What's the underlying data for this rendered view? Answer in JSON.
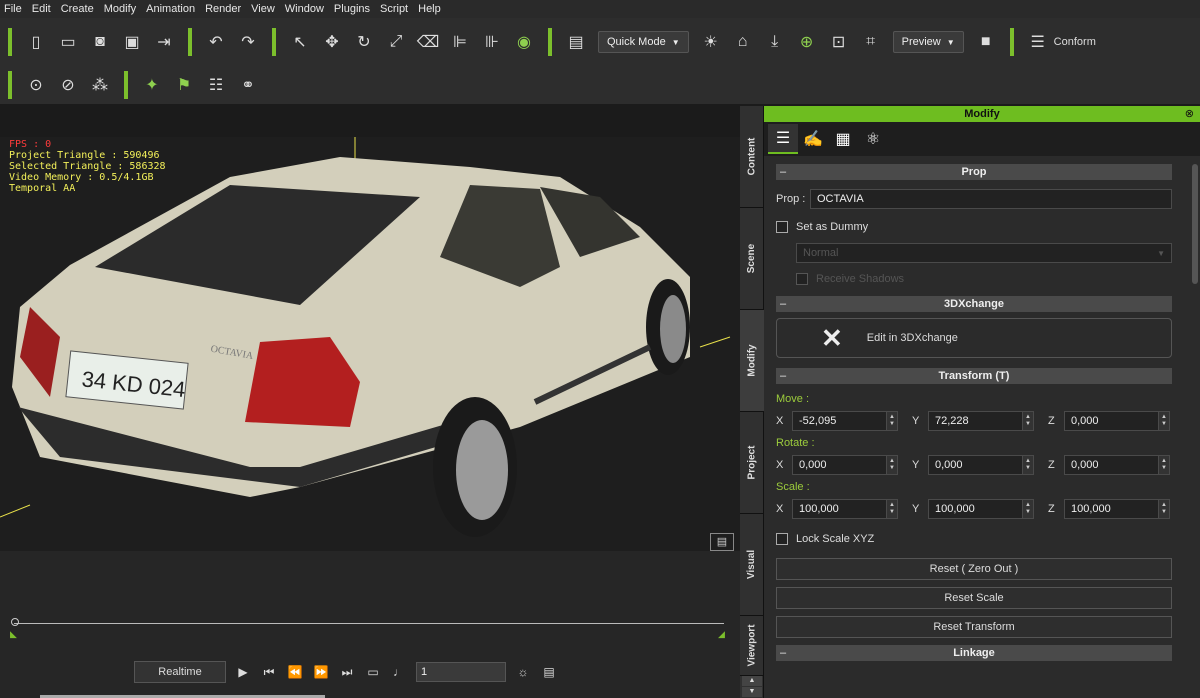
{
  "menu": [
    "File",
    "Edit",
    "Create",
    "Modify",
    "Animation",
    "Render",
    "View",
    "Window",
    "Plugins",
    "Script",
    "Help"
  ],
  "toolbar": {
    "quick_mode": "Quick Mode",
    "preview": "Preview",
    "conform": "Conform"
  },
  "viewport": {
    "stats": {
      "fps": "FPS : 0",
      "project_triangle": "Project Triangle : 590496",
      "selected_triangle": "Selected Triangle : 586328",
      "video_memory": "Video Memory : 0.5/4.1GB",
      "temporal_aa": "Temporal AA"
    },
    "plate": "34 KD 024",
    "badge": "OCTAVIA"
  },
  "playback": {
    "realtime": "Realtime",
    "frame": "1"
  },
  "side_tabs": [
    "Content",
    "Scene",
    "Modify",
    "Project",
    "Visual",
    "Viewport"
  ],
  "panel": {
    "title": "Modify",
    "sections": {
      "prop": "Prop",
      "xchange": "3DXchange",
      "transform": "Transform  (T)",
      "linkage": "Linkage"
    },
    "prop_label": "Prop :",
    "prop_value": "OCTAVIA",
    "set_as_dummy": "Set as Dummy",
    "normal": "Normal",
    "receive_shadows": "Receive Shadows",
    "edit_3dx": "Edit in 3DXchange",
    "move": "Move :",
    "rotate": "Rotate :",
    "scale": "Scale :",
    "move_x": "-52,095",
    "move_y": "72,228",
    "move_z": "0,000",
    "rot_x": "0,000",
    "rot_y": "0,000",
    "rot_z": "0,000",
    "scale_x": "100,000",
    "scale_y": "100,000",
    "scale_z": "100,000",
    "lock_scale": "Lock Scale XYZ",
    "reset_zero": "Reset ( Zero Out )",
    "reset_scale": "Reset Scale",
    "reset_transform": "Reset Transform"
  },
  "colors": {
    "accent": "#6ebd20",
    "stats": "#f3f05a",
    "fps": "#ff3b3b",
    "car": "#d9d6c3"
  }
}
